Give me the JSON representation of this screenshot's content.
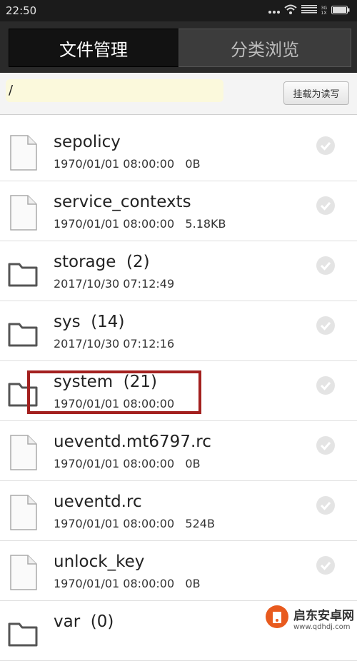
{
  "status_bar": {
    "time": "22:50",
    "signal_top": "3G",
    "signal_bottom": "1X"
  },
  "tabs": [
    {
      "label": "文件管理",
      "active": true
    },
    {
      "label": "分类浏览",
      "active": false
    }
  ],
  "path_bar": {
    "path": "/",
    "mount_button": "挂载为读写"
  },
  "files": [
    {
      "name": "sepolicy",
      "meta": "1970/01/01 08:00:00   0B",
      "type": "file"
    },
    {
      "name": "service_contexts",
      "meta": "1970/01/01 08:00:00   5.18KB",
      "type": "file"
    },
    {
      "name": "storage  (2)",
      "meta": "2017/10/30 07:12:49",
      "type": "folder"
    },
    {
      "name": "sys  (14)",
      "meta": "2017/10/30 07:12:16",
      "type": "folder"
    },
    {
      "name": "system  (21)",
      "meta": "1970/01/01 08:00:00",
      "type": "folder"
    },
    {
      "name": "ueventd.mt6797.rc",
      "meta": "1970/01/01 08:00:00   0B",
      "type": "file"
    },
    {
      "name": "ueventd.rc",
      "meta": "1970/01/01 08:00:00   524B",
      "type": "file"
    },
    {
      "name": "unlock_key",
      "meta": "1970/01/01 08:00:00   0B",
      "type": "file"
    },
    {
      "name": "var  (0)",
      "meta": "",
      "type": "folder"
    }
  ],
  "watermark": {
    "title": "启东安卓网",
    "url": "www.qdhdj.com"
  },
  "colors": {
    "highlight": "#a3201f",
    "tab_bar": "#2a2a2a",
    "path_field": "#fbf9dc"
  }
}
